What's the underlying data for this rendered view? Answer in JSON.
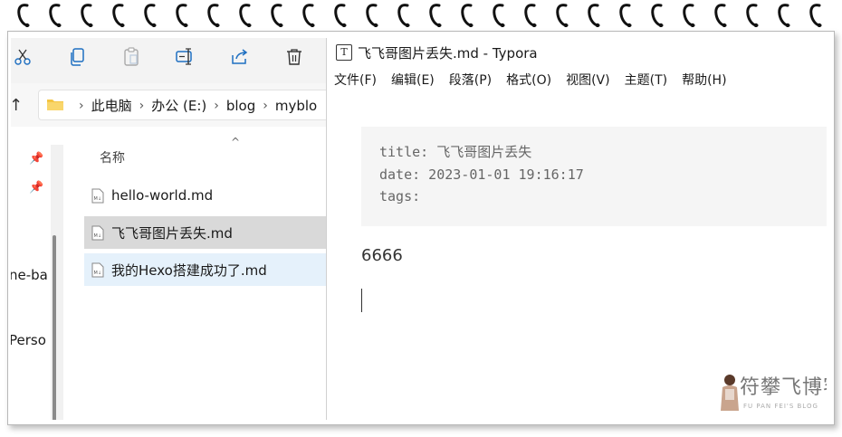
{
  "explorer": {
    "toolbar_icons": [
      "cut-icon",
      "copy-icon",
      "paste-icon",
      "rename-icon",
      "share-icon",
      "delete-icon"
    ],
    "breadcrumb": [
      "此电脑",
      "办公 (E:)",
      "blog",
      "myblo"
    ],
    "nav_items": [
      "ne-ba",
      "Perso"
    ],
    "column_name": "名称",
    "files": [
      {
        "name": "hello-world.md",
        "state": "normal"
      },
      {
        "name": "飞飞哥图片丢失.md",
        "state": "selected"
      },
      {
        "name": "我的Hexo搭建成功了.md",
        "state": "hover"
      }
    ]
  },
  "typora": {
    "title": "飞飞哥图片丢失.md - Typora",
    "logo": "T",
    "menu": [
      "文件(F)",
      "编辑(E)",
      "段落(P)",
      "格式(O)",
      "视图(V)",
      "主题(T)",
      "帮助(H)"
    ],
    "front_matter": [
      "title: 飞飞哥图片丢失",
      "date: 2023-01-01 19:16:17",
      "tags:"
    ],
    "paragraph": "6666"
  },
  "watermark": {
    "text": "符攀飞博客",
    "sub": "FU PAN FEI'S BLOG"
  }
}
